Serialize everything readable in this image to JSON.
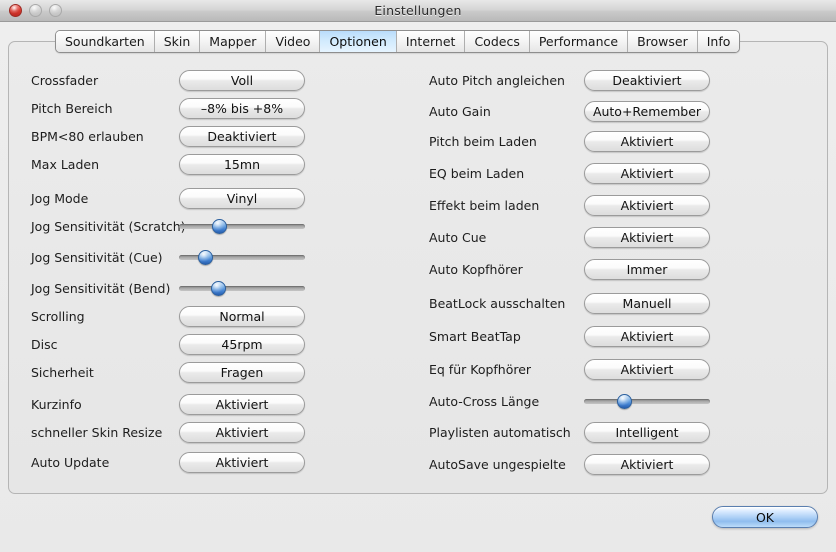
{
  "window": {
    "title": "Einstellungen",
    "controls": [
      {
        "name": "close-button",
        "state": "active"
      },
      {
        "name": "minimize-button",
        "state": "disabled"
      },
      {
        "name": "maximize-button",
        "state": "disabled"
      }
    ]
  },
  "tabs": [
    {
      "label": "Soundkarten",
      "active": false
    },
    {
      "label": "Skin",
      "active": false
    },
    {
      "label": "Mapper",
      "active": false
    },
    {
      "label": "Video",
      "active": false
    },
    {
      "label": "Optionen",
      "active": true
    },
    {
      "label": "Internet",
      "active": false
    },
    {
      "label": "Codecs",
      "active": false
    },
    {
      "label": "Performance",
      "active": false
    },
    {
      "label": "Browser",
      "active": false
    },
    {
      "label": "Info",
      "active": false
    }
  ],
  "left_column": [
    {
      "label": "Crossfader",
      "control": "popup",
      "value": "Voll"
    },
    {
      "label": "Pitch Bereich",
      "control": "popup",
      "value": "–8% bis +8%"
    },
    {
      "label": "BPM<80 erlauben",
      "control": "popup",
      "value": "Deaktiviert"
    },
    {
      "label": "Max Laden",
      "control": "popup",
      "value": "15mn"
    },
    {
      "label": "Jog Mode",
      "control": "popup",
      "value": "Vinyl"
    },
    {
      "label": "Jog Sensitivität (Scratch)",
      "control": "slider",
      "percent": 30
    },
    {
      "label": "Jog Sensitivität (Cue)",
      "control": "slider",
      "percent": 17
    },
    {
      "label": "Jog Sensitivität (Bend)",
      "control": "slider",
      "percent": 29
    },
    {
      "label": "Scrolling",
      "control": "popup",
      "value": "Normal"
    },
    {
      "label": "Disc",
      "control": "popup",
      "value": "45rpm"
    },
    {
      "label": "Sicherheit",
      "control": "popup",
      "value": "Fragen"
    },
    {
      "label": "Kurzinfo",
      "control": "popup",
      "value": "Aktiviert"
    },
    {
      "label": "schneller Skin Resize",
      "control": "popup",
      "value": "Aktiviert"
    },
    {
      "label": "Auto Update",
      "control": "popup",
      "value": "Aktiviert"
    }
  ],
  "right_column": [
    {
      "label": "Auto Pitch angleichen",
      "control": "popup",
      "value": "Deaktiviert"
    },
    {
      "label": "Auto Gain",
      "control": "popup",
      "value": "Auto+Remember"
    },
    {
      "label": "Pitch beim Laden",
      "control": "popup",
      "value": "Aktiviert"
    },
    {
      "label": "EQ beim Laden",
      "control": "popup",
      "value": "Aktiviert"
    },
    {
      "label": "Effekt beim laden",
      "control": "popup",
      "value": "Aktiviert"
    },
    {
      "label": "Auto Cue",
      "control": "popup",
      "value": "Aktiviert"
    },
    {
      "label": "Auto Kopfhörer",
      "control": "popup",
      "value": "Immer"
    },
    {
      "label": "BeatLock ausschalten",
      "control": "popup",
      "value": "Manuell"
    },
    {
      "label": "Smart BeatTap",
      "control": "popup",
      "value": "Aktiviert"
    },
    {
      "label": "Eq für Kopfhörer",
      "control": "popup",
      "value": "Aktiviert"
    },
    {
      "label": "Auto-Cross Länge",
      "control": "slider",
      "percent": 30
    },
    {
      "label": "Playlisten automatisch",
      "control": "popup",
      "value": "Intelligent"
    },
    {
      "label": "AutoSave ungespielte",
      "control": "popup",
      "value": "Aktiviert"
    }
  ],
  "footer": {
    "ok_label": "OK"
  },
  "colors": {
    "accent": "#3f7fd0",
    "active_tab": "#b9dcfb",
    "window_chrome": "#d4d4d4",
    "panel_bg": "#ebebeb",
    "close_button": "#d93b31"
  }
}
